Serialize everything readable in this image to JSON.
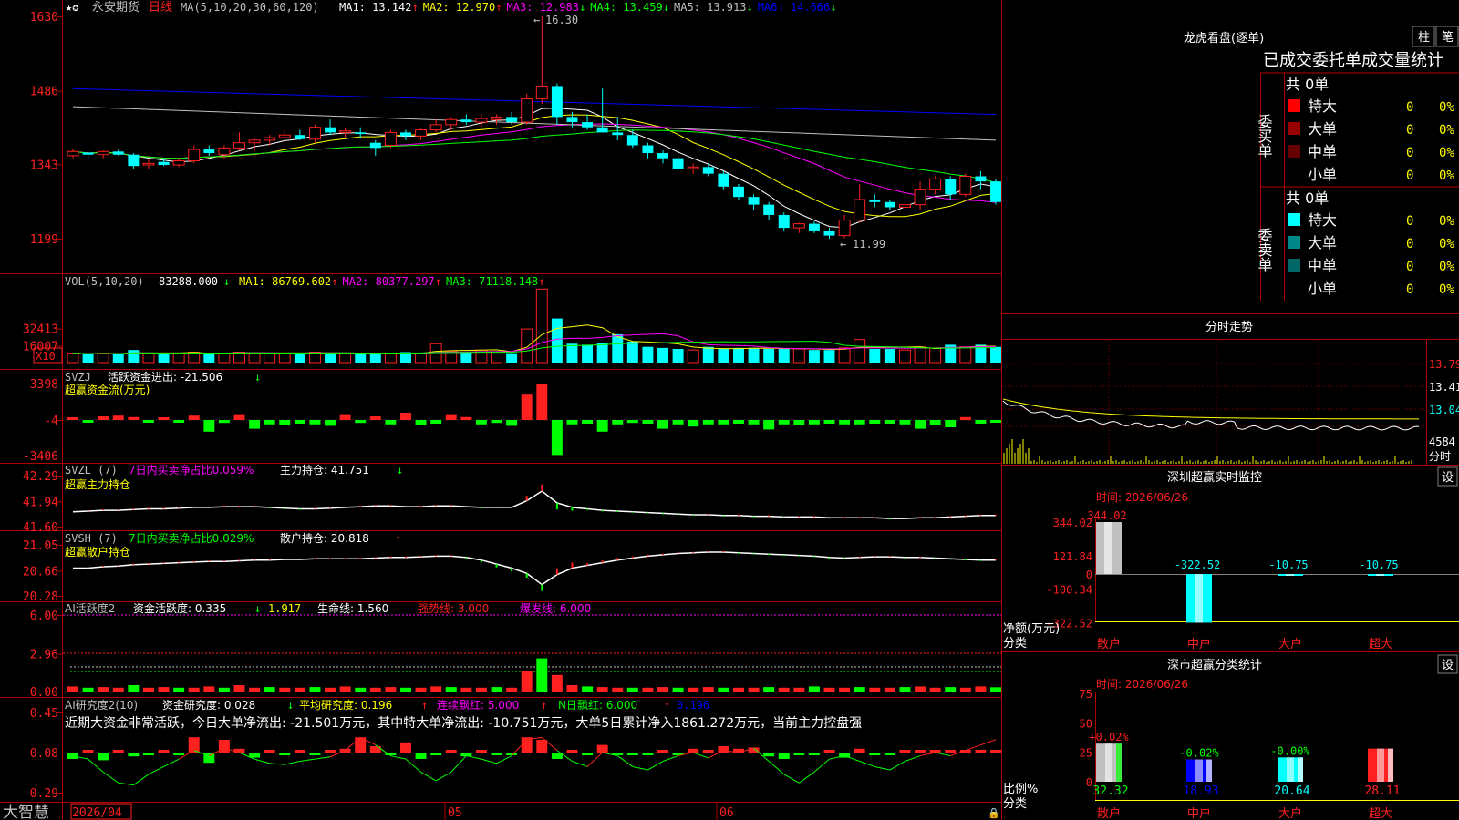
{
  "colors": {
    "up": "#ff2020",
    "down": "#00ffff",
    "grid": "#b00000",
    "ma1": "#ffffff",
    "ma2": "#ffff00",
    "ma3": "#ff00ff",
    "ma4": "#00ff00",
    "ma5": "#c0c0c0",
    "ma6": "#0000ff"
  },
  "main": {
    "title": "永安期货",
    "period": "日线",
    "ma_params": "MA(5,10,20,30,60,120)",
    "ma_labels": [
      {
        "text": "MA1: 13.142",
        "color": "#ffffff",
        "arrow": "↑",
        "arrow_color": "#ff2020"
      },
      {
        "text": "MA2: 12.970",
        "color": "#ffff00",
        "arrow": "↑",
        "arrow_color": "#ff2020"
      },
      {
        "text": "MA3: 12.983",
        "color": "#ff00ff",
        "arrow": "↓",
        "arrow_color": "#00ff00"
      },
      {
        "text": "MA4: 13.459",
        "color": "#00ff00",
        "arrow": "↓",
        "arrow_color": "#00ff00"
      },
      {
        "text": "MA5: 13.913",
        "color": "#c0c0c0",
        "arrow": "↓",
        "arrow_color": "#00ff00"
      },
      {
        "text": "MA6: 14.666",
        "color": "#0000ff",
        "arrow": "↓",
        "arrow_color": "#00ff00"
      }
    ],
    "y_ticks": [
      "1630",
      "1486",
      "1343",
      "1199"
    ],
    "high_label": "16.30",
    "low_label": "11.99",
    "star_icons": "★✪"
  },
  "candles": [
    [
      13.6,
      13.72,
      13.55,
      13.68
    ],
    [
      13.66,
      13.7,
      13.5,
      13.62
    ],
    [
      13.62,
      13.7,
      13.55,
      13.68
    ],
    [
      13.68,
      13.72,
      13.6,
      13.62
    ],
    [
      13.62,
      13.65,
      13.35,
      13.4
    ],
    [
      13.42,
      13.55,
      13.35,
      13.45
    ],
    [
      13.48,
      13.55,
      13.4,
      13.42
    ],
    [
      13.42,
      13.55,
      13.38,
      13.5
    ],
    [
      13.5,
      13.8,
      13.45,
      13.72
    ],
    [
      13.72,
      13.8,
      13.6,
      13.65
    ],
    [
      13.62,
      13.8,
      13.55,
      13.75
    ],
    [
      13.75,
      14.05,
      13.7,
      13.85
    ],
    [
      13.85,
      13.95,
      13.7,
      13.9
    ],
    [
      13.9,
      14.0,
      13.8,
      13.95
    ],
    [
      13.95,
      14.1,
      13.9,
      14.0
    ],
    [
      14.0,
      14.1,
      13.9,
      13.92
    ],
    [
      13.92,
      14.2,
      13.85,
      14.15
    ],
    [
      14.15,
      14.3,
      14.0,
      14.05
    ],
    [
      14.05,
      14.15,
      13.95,
      14.08
    ],
    [
      14.05,
      14.15,
      13.95,
      14.02
    ],
    [
      13.85,
      13.9,
      13.6,
      13.75
    ],
    [
      13.8,
      14.1,
      13.75,
      14.05
    ],
    [
      14.05,
      14.1,
      13.9,
      13.98
    ],
    [
      13.98,
      14.15,
      13.9,
      14.1
    ],
    [
      14.1,
      14.3,
      14.05,
      14.2
    ],
    [
      14.2,
      14.35,
      14.1,
      14.3
    ],
    [
      14.3,
      14.4,
      14.2,
      14.25
    ],
    [
      14.25,
      14.4,
      14.15,
      14.32
    ],
    [
      14.3,
      14.4,
      14.2,
      14.35
    ],
    [
      14.35,
      14.45,
      14.2,
      14.25
    ],
    [
      14.25,
      14.8,
      14.2,
      14.7
    ],
    [
      14.7,
      16.3,
      14.6,
      14.95
    ],
    [
      14.95,
      15.0,
      14.2,
      14.35
    ],
    [
      14.35,
      14.45,
      14.15,
      14.25
    ],
    [
      14.25,
      14.4,
      14.1,
      14.15
    ],
    [
      14.15,
      14.9,
      14.05,
      14.05
    ],
    [
      14.05,
      14.35,
      13.9,
      14.0
    ],
    [
      14.0,
      14.1,
      13.75,
      13.8
    ],
    [
      13.8,
      13.85,
      13.55,
      13.65
    ],
    [
      13.65,
      13.7,
      13.45,
      13.55
    ],
    [
      13.55,
      13.6,
      13.3,
      13.35
    ],
    [
      13.35,
      13.45,
      13.25,
      13.38
    ],
    [
      13.38,
      13.45,
      13.2,
      13.25
    ],
    [
      13.25,
      13.3,
      12.95,
      13.0
    ],
    [
      13.0,
      13.05,
      12.75,
      12.8
    ],
    [
      12.8,
      12.85,
      12.55,
      12.65
    ],
    [
      12.65,
      12.7,
      12.35,
      12.45
    ],
    [
      12.45,
      12.5,
      12.15,
      12.2
    ],
    [
      12.2,
      12.3,
      12.1,
      12.28
    ],
    [
      12.28,
      12.32,
      12.1,
      12.15
    ],
    [
      12.15,
      12.2,
      11.99,
      12.05
    ],
    [
      12.05,
      12.45,
      12.0,
      12.35
    ],
    [
      12.35,
      13.05,
      12.3,
      12.75
    ],
    [
      12.75,
      12.85,
      12.6,
      12.7
    ],
    [
      12.7,
      12.75,
      12.55,
      12.6
    ],
    [
      12.6,
      12.7,
      12.45,
      12.65
    ],
    [
      12.65,
      13.1,
      12.55,
      12.95
    ],
    [
      12.95,
      13.2,
      12.85,
      13.15
    ],
    [
      13.15,
      13.2,
      12.75,
      12.85
    ],
    [
      12.85,
      13.25,
      12.8,
      13.2
    ],
    [
      13.2,
      13.3,
      12.95,
      13.1
    ],
    [
      13.1,
      13.15,
      12.65,
      12.7
    ]
  ],
  "ma_params_list": [
    5,
    10,
    20,
    30,
    60,
    120
  ],
  "ma_long_levels": {
    "ma5": [
      14.55,
      13.9
    ],
    "ma6": [
      14.9,
      14.4
    ]
  },
  "vol": {
    "title": "VOL(5,10,20)",
    "value": "83288.000",
    "value_arrow": "↓",
    "labels": [
      {
        "text": "MA1: 86769.602",
        "color": "#ffff00",
        "arrow": "↑"
      },
      {
        "text": "MA2: 80377.297",
        "color": "#ff00ff",
        "arrow": "↑"
      },
      {
        "text": "MA3: 71118.148",
        "color": "#00ff00",
        "arrow": "↑"
      }
    ],
    "y_ticks": [
      "32413",
      "16007"
    ],
    "unit": "X10",
    "values": [
      9,
      8,
      9,
      8,
      12,
      9,
      8,
      9,
      10,
      9,
      9,
      10,
      9,
      9,
      9,
      9,
      10,
      9,
      9,
      8,
      8,
      9,
      10,
      9,
      18,
      11,
      10,
      12,
      10,
      9,
      32,
      70,
      42,
      18,
      17,
      19,
      27,
      20,
      15,
      14,
      13,
      12,
      15,
      13,
      14,
      14,
      13,
      13,
      13,
      12,
      12,
      14,
      22,
      13,
      13,
      12,
      15,
      14,
      17,
      15,
      17,
      15
    ]
  },
  "svzj": {
    "title": "SVZJ",
    "label": "活跃资金进出: -21.506",
    "label_arrow": "↓",
    "sub": "超赢资金流(万元)",
    "y_ticks": [
      "3398",
      "-4",
      "-3406"
    ],
    "values": [
      150,
      -150,
      250,
      300,
      200,
      -100,
      150,
      -100,
      300,
      -800,
      -200,
      400,
      -600,
      -300,
      -350,
      -250,
      -300,
      -400,
      400,
      -200,
      250,
      -300,
      500,
      -350,
      -250,
      400,
      200,
      -300,
      -200,
      -400,
      1800,
      2500,
      -2400,
      -300,
      -250,
      -800,
      -300,
      -200,
      -250,
      -600,
      -300,
      -450,
      -300,
      -300,
      -250,
      -300,
      -650,
      -300,
      -350,
      -300,
      -250,
      -300,
      -300,
      -250,
      -250,
      -300,
      -600,
      -350,
      -500,
      200,
      -250,
      -50
    ]
  },
  "svzl": {
    "title": "SVZL (7)",
    "ratio": "7日内买卖净占比0.059%",
    "hold": "主力持仓: 41.751",
    "arrow": "↓",
    "sub": "超赢主力持仓",
    "y_ticks": [
      "42.29",
      "41.94",
      "41.60"
    ],
    "values": [
      41.8,
      41.81,
      41.82,
      41.82,
      41.83,
      41.84,
      41.84,
      41.85,
      41.86,
      41.86,
      41.87,
      41.87,
      41.87,
      41.86,
      41.85,
      41.84,
      41.84,
      41.85,
      41.86,
      41.87,
      41.88,
      41.88,
      41.87,
      41.87,
      41.88,
      41.88,
      41.87,
      41.86,
      41.86,
      41.86,
      41.95,
      42.08,
      41.92,
      41.86,
      41.84,
      41.82,
      41.81,
      41.8,
      41.79,
      41.78,
      41.77,
      41.76,
      41.76,
      41.75,
      41.75,
      41.74,
      41.74,
      41.73,
      41.73,
      41.73,
      41.72,
      41.72,
      41.72,
      41.72,
      41.71,
      41.71,
      41.72,
      41.72,
      41.73,
      41.74,
      41.75,
      41.75
    ]
  },
  "svsh": {
    "title": "SVSH (7)",
    "ratio": "7日内买卖净占比0.029%",
    "hold": "散户持仓: 20.818",
    "arrow": "↑",
    "sub": "超赢散户持仓",
    "y_ticks": [
      "21.05",
      "20.66",
      "20.28"
    ],
    "values": [
      20.7,
      20.7,
      20.72,
      20.73,
      20.75,
      20.76,
      20.77,
      20.78,
      20.79,
      20.8,
      20.8,
      20.81,
      20.82,
      20.82,
      20.83,
      20.83,
      20.84,
      20.84,
      20.84,
      20.84,
      20.85,
      20.86,
      20.86,
      20.87,
      20.88,
      20.88,
      20.86,
      20.82,
      20.76,
      20.7,
      20.62,
      20.45,
      20.6,
      20.7,
      20.74,
      20.78,
      20.82,
      20.85,
      20.88,
      20.9,
      20.92,
      20.93,
      20.94,
      20.94,
      20.93,
      20.92,
      20.91,
      20.9,
      20.89,
      20.88,
      20.86,
      20.85,
      20.86,
      20.87,
      20.87,
      20.86,
      20.86,
      20.85,
      20.84,
      20.83,
      20.82,
      20.82
    ]
  },
  "ai_active": {
    "title": "AI活跃度2",
    "fund": "资金活跃度: 0.335",
    "fund_arrow": "↓",
    "val2": "1.917",
    "life": "生命线: 1.560",
    "strong": "强势线: 3.000",
    "burst": "爆发线: 6.000",
    "y_ticks": [
      "6.00",
      "2.96",
      "0.00"
    ],
    "values": [
      0.4,
      0.3,
      0.35,
      0.3,
      0.5,
      0.3,
      0.35,
      0.3,
      0.3,
      0.4,
      0.3,
      0.5,
      0.3,
      0.35,
      0.3,
      0.3,
      0.35,
      0.3,
      0.4,
      0.3,
      0.3,
      0.35,
      0.3,
      0.3,
      0.4,
      0.35,
      0.3,
      0.3,
      0.35,
      0.3,
      1.6,
      2.6,
      1.3,
      0.5,
      0.4,
      0.35,
      0.3,
      0.3,
      0.3,
      0.35,
      0.3,
      0.3,
      0.35,
      0.3,
      0.3,
      0.3,
      0.35,
      0.3,
      0.3,
      0.4,
      0.3,
      0.3,
      0.35,
      0.3,
      0.3,
      0.35,
      0.4,
      0.3,
      0.35,
      0.3,
      0.4,
      0.335
    ]
  },
  "ai_research": {
    "title": "AI研究度2(10)",
    "fund": "资金研究度: 0.028",
    "fund_arrow": "↓",
    "avg": "平均研究度: 0.196",
    "avg_arrow": "↑",
    "red": "连续飘红: 5.000",
    "red_arrow": "↑",
    "nred": "N日飘红: 6.000",
    "nred_arrow": "↑",
    "last": "0.196",
    "note": "近期大资金非常活跃，今日大单净流出: -21.501万元，其中特大单净流出: -10.751万元，大单5日累计净入1861.272万元，当前主力控盘强",
    "y_ticks": [
      "0.45",
      "0.08",
      "-0.29"
    ],
    "bars": [
      -0.05,
      0.02,
      -0.06,
      0.01,
      -0.03,
      -0.02,
      0.01,
      -0.02,
      0.12,
      -0.08,
      0.1,
      0.03,
      -0.04,
      0.02,
      -0.02,
      0.01,
      -0.02,
      0.02,
      0.03,
      0.12,
      0.05,
      -0.02,
      0.08,
      -0.05,
      -0.02,
      0.01,
      -0.03,
      0.01,
      -0.02,
      -0.01,
      0.12,
      0.1,
      -0.05,
      0.01,
      -0.02,
      0.06,
      -0.02,
      -0.01,
      -0.02,
      0.02,
      -0.02,
      0.03,
      0.02,
      0.05,
      0.03,
      0.04,
      -0.03,
      -0.05,
      -0.02,
      -0.02,
      0.02,
      -0.04,
      0.03,
      -0.02,
      -0.01,
      0.01,
      0.02,
      0.01,
      0.02,
      0.02,
      0.02,
      0.02
    ],
    "line": [
      0.05,
      0.02,
      -0.1,
      -0.2,
      -0.22,
      -0.12,
      -0.05,
      0.02,
      0.1,
      0.05,
      0.12,
      0.08,
      0.02,
      -0.02,
      -0.03,
      0.0,
      0.02,
      0.04,
      0.1,
      0.22,
      0.15,
      0.05,
      0.02,
      -0.1,
      -0.18,
      -0.1,
      0.05,
      0.02,
      -0.02,
      0.05,
      0.2,
      0.22,
      0.1,
      0.0,
      -0.05,
      0.08,
      0.05,
      -0.05,
      -0.08,
      0.0,
      0.05,
      0.08,
      0.03,
      0.1,
      0.08,
      0.12,
      0.0,
      -0.12,
      -0.2,
      -0.1,
      0.02,
      0.05,
      0.0,
      -0.05,
      -0.08,
      0.0,
      0.05,
      0.08,
      0.05,
      0.1,
      0.15,
      0.2
    ]
  },
  "x_axis": {
    "labels": [
      "2026/04",
      "05",
      "06"
    ],
    "app_name": "大智慧"
  },
  "longhu": {
    "title": "龙虎看盘(逐单)",
    "btn1": "柱",
    "btn2": "笔",
    "headline": "已成交委托单成交量统计",
    "buy_side": "委买单",
    "sell_side": "委卖单",
    "buy_total": "共 0单",
    "sell_total": "共 0单",
    "buy_rows": [
      {
        "name": "特大",
        "color": "#ff0000",
        "count": "0",
        "pct": "0%"
      },
      {
        "name": "大单",
        "color": "#990000",
        "count": "0",
        "pct": "0%"
      },
      {
        "name": "中单",
        "color": "#660000",
        "count": "0",
        "pct": "0%"
      },
      {
        "name": "小单",
        "color": "#000000",
        "count": "0",
        "pct": "0%"
      }
    ],
    "sell_rows": [
      {
        "name": "特大",
        "color": "#00ffff",
        "count": "0",
        "pct": "0%"
      },
      {
        "name": "大单",
        "color": "#008888",
        "count": "0",
        "pct": "0%"
      },
      {
        "name": "中单",
        "color": "#006666",
        "count": "0",
        "pct": "0%"
      },
      {
        "name": "小单",
        "color": "#000000",
        "count": "0",
        "pct": "0%"
      }
    ]
  },
  "intraday": {
    "title": "分时走势",
    "price_ticks": [
      "13.79",
      "13.41",
      "13.04"
    ],
    "vol_label": "4584",
    "unit": "分时"
  },
  "monitor": {
    "title": "深圳超赢实时监控",
    "set": "设",
    "time": "时间: 2026/06/26",
    "y_ticks": [
      "344.02",
      "121.84",
      "0",
      "-100.34",
      "-322.52"
    ],
    "y_label": "净额(万元)",
    "x_label": "分类",
    "bars": [
      {
        "name": "散户",
        "value": 344.02,
        "label": "344.02",
        "color": "#c0c0c0"
      },
      {
        "name": "中户",
        "value": -322.52,
        "label": "-322.52",
        "color": "#00ffff"
      },
      {
        "name": "大户",
        "value": -10.75,
        "label": "-10.75",
        "color": "#00ffff"
      },
      {
        "name": "超大",
        "value": -10.75,
        "label": "-10.75",
        "color": "#00ffff"
      }
    ]
  },
  "classify": {
    "title": "深市超赢分类统计",
    "set": "设",
    "time": "时间: 2026/06/26",
    "y_ticks": [
      "75",
      "50",
      "25",
      "0"
    ],
    "y_label": "比例%",
    "x_label": "分类",
    "bars": [
      {
        "name": "散户",
        "pct": 32.32,
        "label": "32.32",
        "delta": "+0.02%",
        "delta_color": "#ff2020",
        "color": "#c0c0c0",
        "accent": "#00ff00"
      },
      {
        "name": "中户",
        "pct": 18.93,
        "label": "18.93",
        "delta": "-0.02%",
        "delta_color": "#00ff00",
        "color": "#0000ff",
        "accent": "#ffffff"
      },
      {
        "name": "大户",
        "pct": 20.64,
        "label": "20.64",
        "delta": "-0.00%",
        "delta_color": "#00ff00",
        "color": "#00ffff",
        "accent": "#ffffff"
      },
      {
        "name": "超大",
        "pct": 28.11,
        "label": "28.11",
        "delta": "",
        "delta_color": "#ff2020",
        "color": "#ff2020",
        "accent": "#ffffff"
      }
    ]
  }
}
